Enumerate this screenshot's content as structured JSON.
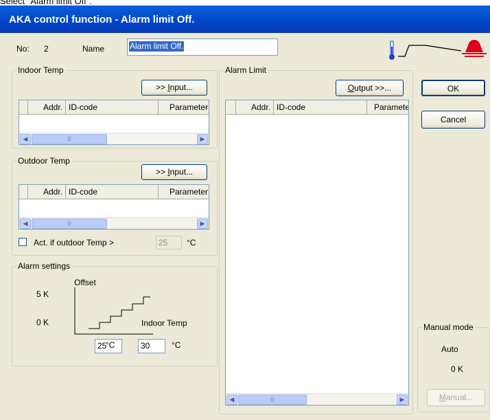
{
  "caption": "Select \"Alarm limit Off\".",
  "window": {
    "title": "AKA control function - Alarm limit Off."
  },
  "header": {
    "no_label": "No:",
    "no_value": "2",
    "name_label": "Name",
    "name_value": "Alarm limit Off."
  },
  "indoor": {
    "legend": "Indoor Temp",
    "input_prefix": ">> ",
    "input_mnemonic": "I",
    "input_rest": "nput...",
    "columns": [
      "Addr.",
      "ID-code",
      "Parameter"
    ]
  },
  "outdoor": {
    "legend": "Outdoor Temp",
    "input_prefix": ">> ",
    "input_mnemonic": "I",
    "input_rest": "nput...",
    "columns": [
      "Addr.",
      "ID-code",
      "Parameter"
    ],
    "act_label": "Act. if outdoor Temp >",
    "act_value": "25",
    "act_unit": "°C"
  },
  "alarm_settings": {
    "legend": "Alarm settings",
    "offset_label": "Offset",
    "k5": "5  K",
    "k0": "0  K",
    "indoor_temp_label": "Indoor Temp",
    "low_value": "25",
    "low_unit": "°C",
    "high_value": "30",
    "high_unit": "°C"
  },
  "alarm_limit": {
    "legend": "Alarm Limit",
    "output_mnemonic": "O",
    "output_rest": "utput >>...",
    "columns": [
      "Addr.",
      "ID-code",
      "Paramete"
    ]
  },
  "buttons": {
    "ok": "OK",
    "cancel": "Cancel",
    "manual_mnemonic": "M",
    "manual_rest": "anual..."
  },
  "manual_mode": {
    "legend": "Manual mode",
    "mode": "Auto",
    "value": "0  K"
  },
  "colors": {
    "titlebar": "#0054e3",
    "dialog_bg": "#ece9d8",
    "bell": "#e0001a",
    "thermometer": "#1b3fd1"
  }
}
